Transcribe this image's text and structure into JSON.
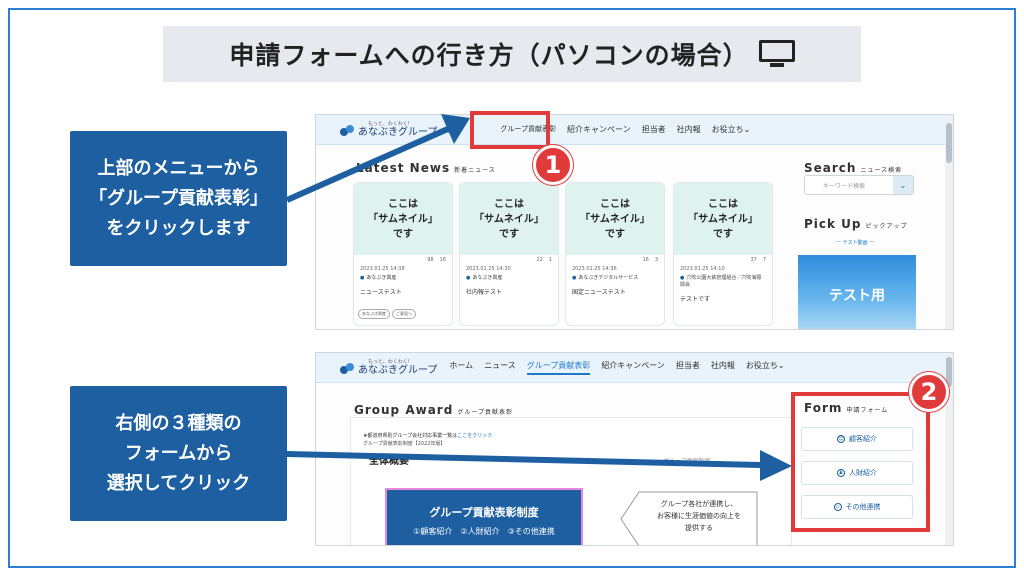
{
  "title": "申請フォームへの行き方（パソコンの場合）",
  "callouts": {
    "first": "上部のメニューから\n「グループ貢献表彰」\nをクリックします",
    "second": "右側の３種類の\nフォームから\n選択してクリック"
  },
  "badges": {
    "one": "1",
    "two": "2"
  },
  "site": {
    "logo_tagline": "もっと、わくわく!",
    "logo_name": "あなぶきグループ",
    "nav": [
      "ホーム",
      "ニュース",
      "グループ貢献表彰",
      "紹介キャンペーン",
      "担当者",
      "社内報",
      "お役立ち"
    ]
  },
  "shot1": {
    "nav_partial": "ホ",
    "nav_visible": [
      "グループ貢献表彰",
      "紹介キャンペーン",
      "担当者",
      "社内報",
      "お役立ち"
    ],
    "latest_news": "Latest News",
    "latest_news_sub": "新着ニュース",
    "cards": [
      {
        "thumb": "ここは\n「サムネイル」\nです",
        "views": "98",
        "likes": "16",
        "date": "2023.01.25 14:38",
        "category": "あなぶき興産",
        "title": "ニューステスト",
        "tags": [
          "あなぶき興産",
          "ご意見へ"
        ]
      },
      {
        "thumb": "ここは\n「サムネイル」\nです",
        "views": "22",
        "likes": "1",
        "date": "2023.01.25 14:30",
        "category": "あなぶき興産",
        "title": "社内報テスト",
        "tags": []
      },
      {
        "thumb": "ここは\n「サムネイル」\nです",
        "views": "16",
        "likes": "3",
        "date": "2023.01.25 14:36",
        "category": "あなぶきデジタルサービス",
        "title": "国定ニューステスト",
        "tags": []
      },
      {
        "thumb": "ここは\n「サムネイル」\nです",
        "views": "37",
        "likes": "7",
        "date": "2023.01.25 14:10",
        "category": "穴吹公園大鉄管理組合／穴吹海振興会",
        "title": "テストです",
        "tags": []
      }
    ],
    "search_title": "Search",
    "search_sub": "ニュース検索",
    "search_placeholder": "キーワード検索",
    "pickup_title": "Pick Up",
    "pickup_sub": "ピックアップ",
    "pickup_label": "ー テスト動画 ー",
    "pickup_image_text": "テスト用"
  },
  "shot2": {
    "group_award": "Group Award",
    "group_award_sub": "グループ貢献表彰",
    "notice_prefix": "★都道府県別グループ会社対応事業一覧は",
    "notice_link": "ここをクリック",
    "notice2": "グループ貢献表彰制度【2022年版】",
    "overview": "全体概要",
    "faint_label": "グループ貢献制度",
    "system_title": "グループ貢献表彰制度",
    "system_sub": "①顧客紹介　②人財紹介　③その他連携",
    "arrow_text": "グループ各社が連携し、\nお客様に生涯価値の向上を\n提供する",
    "form_title": "Form",
    "form_sub": "申請フォーム",
    "forms": [
      "顧客紹介",
      "人財紹介",
      "その他連携"
    ]
  },
  "colors": {
    "accent": "#1d5fa0",
    "highlight": "#e03a3a",
    "arrow": "#1d5fa0"
  }
}
